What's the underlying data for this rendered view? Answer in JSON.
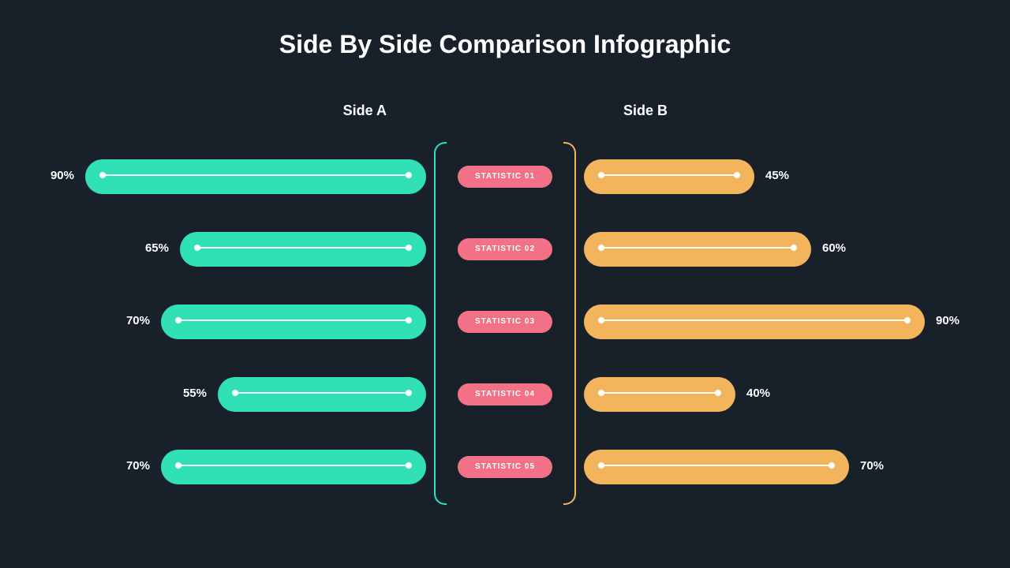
{
  "title": "Side By Side Comparison Infographic",
  "side_a_label": "Side A",
  "side_b_label": "Side B",
  "colors": {
    "bg": "#18202a",
    "side_a": "#31e0b5",
    "side_b": "#f3b55c",
    "stat": "#f27186",
    "text": "#ffffff"
  },
  "chart_data": {
    "type": "bar",
    "title": "Side By Side Comparison Infographic",
    "categories": [
      "STATISTIC  01",
      "STATISTIC  02",
      "STATISTIC  03",
      "STATISTIC  04",
      "STATISTIC  05"
    ],
    "series": [
      {
        "name": "Side A",
        "values": [
          90,
          65,
          70,
          55,
          70
        ]
      },
      {
        "name": "Side B",
        "values": [
          45,
          60,
          90,
          40,
          70
        ]
      }
    ],
    "xlabel": "",
    "ylabel": "",
    "ylim": [
      0,
      100
    ]
  },
  "rows": [
    {
      "stat": "STATISTIC  01",
      "a_pct": "90%",
      "b_pct": "45%",
      "a_val": 90,
      "b_val": 45
    },
    {
      "stat": "STATISTIC  02",
      "a_pct": "65%",
      "b_pct": "60%",
      "a_val": 65,
      "b_val": 60
    },
    {
      "stat": "STATISTIC  03",
      "a_pct": "70%",
      "b_pct": "90%",
      "a_val": 70,
      "b_val": 90
    },
    {
      "stat": "STATISTIC  04",
      "a_pct": "55%",
      "b_pct": "40%",
      "a_val": 55,
      "b_val": 40
    },
    {
      "stat": "STATISTIC  05",
      "a_pct": "70%",
      "b_pct": "70%",
      "a_val": 70,
      "b_val": 70
    }
  ]
}
